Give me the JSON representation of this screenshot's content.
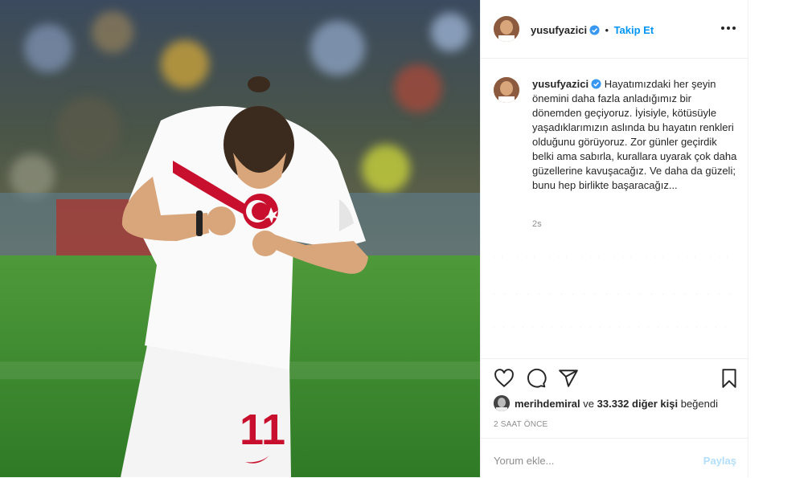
{
  "post": {
    "username": "yusufyazici",
    "separator": "•",
    "follow_label": "Takip Et",
    "more_icon": "more-options-icon",
    "verified_icon": "verified-badge-icon",
    "caption_text": "Hayatımızdaki her şeyin önemini daha fazla anladığımız bir dönemden geçiyoruz. İyisiyle, kötüsüyle yaşadıklarımızın aslında bu hayatın renkleri olduğunu görüyoruz. Zor günler geçirdik belki ama sabırla, kurallara uyarak çok daha güzellerine kavuşacağız. Ve daha da güzeli; bunu hep birlikte başaracağız...",
    "caption_time": "2s",
    "likes": {
      "liker": "merihdemiral",
      "connector": "ve",
      "count_text": "33.332 diğer kişi",
      "suffix": "beğendi"
    },
    "time_ago": "2 SAAT ÖNCE",
    "comment_placeholder": "Yorum ekle...",
    "post_button": "Paylaş",
    "photo": {
      "jersey_number": "11"
    }
  },
  "colors": {
    "accent": "#0095f6",
    "post_disabled": "#b2dffc",
    "muted": "#8e8e8e",
    "jersey_red": "#c8102e"
  }
}
